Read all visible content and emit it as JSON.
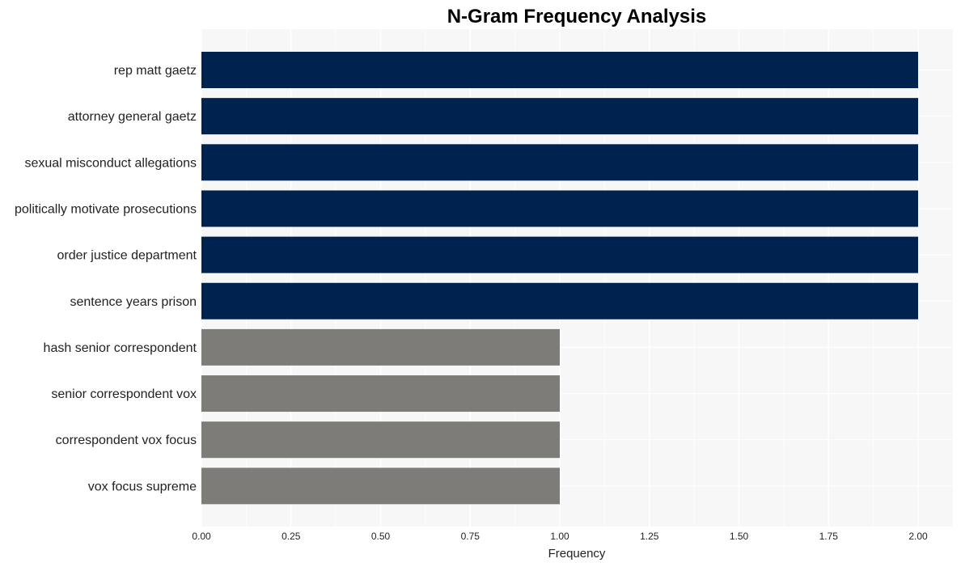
{
  "chart_data": {
    "type": "bar",
    "orientation": "horizontal",
    "title": "N-Gram Frequency Analysis",
    "xlabel": "Frequency",
    "ylabel": "",
    "xlim": [
      0,
      2.1
    ],
    "grid": true,
    "legend": "none",
    "x_ticks": [
      "0.00",
      "0.25",
      "0.50",
      "0.75",
      "1.00",
      "1.25",
      "1.50",
      "1.75",
      "2.00"
    ],
    "x_tick_values": [
      0,
      0.25,
      0.5,
      0.75,
      1.0,
      1.25,
      1.5,
      1.75,
      2.0
    ],
    "categories": [
      "rep matt gaetz",
      "attorney general gaetz",
      "sexual misconduct allegations",
      "politically motivate prosecutions",
      "order justice department",
      "sentence years prison",
      "hash senior correspondent",
      "senior correspondent vox",
      "correspondent vox focus",
      "vox focus supreme"
    ],
    "values": [
      2,
      2,
      2,
      2,
      2,
      2,
      1,
      1,
      1,
      1
    ],
    "colors": {
      "high": "#00224e",
      "low": "#7d7c78",
      "plot_background": "#f7f7f7",
      "grid": "#ffffff"
    }
  }
}
